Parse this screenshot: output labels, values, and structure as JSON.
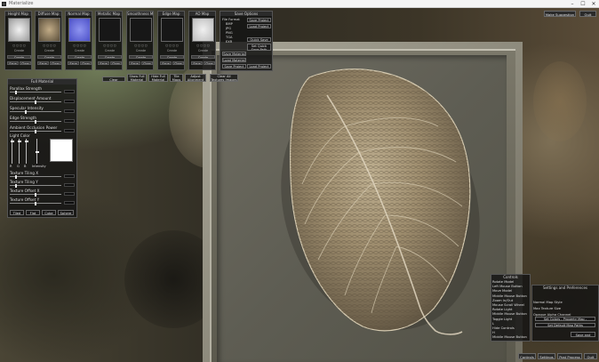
{
  "window": {
    "title": "Materialize",
    "controls": [
      "–",
      "☐",
      "✕"
    ]
  },
  "maps": [
    {
      "title": "Height Map",
      "image": "height",
      "subtitle": "Create",
      "buttons": [
        "Save",
        "Clear"
      ]
    },
    {
      "title": "Diffuse Map",
      "image": "diffuse",
      "subtitle": "Create",
      "buttons": [
        "Save",
        "Clear"
      ]
    },
    {
      "title": "Normal Map",
      "image": "normal",
      "subtitle": "Create",
      "buttons": [
        "Save",
        "Clear"
      ]
    },
    {
      "title": "Metallic Map",
      "image": "empty",
      "subtitle": "Create",
      "buttons": [
        "Save",
        "Clear"
      ]
    },
    {
      "title": "Smoothness Map",
      "image": "empty",
      "subtitle": "Create",
      "buttons": [
        "Save",
        "Clear"
      ]
    },
    {
      "title": "Edge Map",
      "image": "empty",
      "subtitle": "Create",
      "buttons": [
        "Save",
        "Clear"
      ]
    },
    {
      "title": "AO Map",
      "image": "ao",
      "subtitle": "Create",
      "buttons": [
        "Save",
        "Clear"
      ]
    }
  ],
  "save_panel": {
    "title": "Save Options",
    "options": [
      "File Format",
      "BMP",
      "JPG",
      "PNG",
      "TGA",
      "EXR"
    ],
    "right_buttons": [
      "Save Project",
      "Load Project",
      "Quick Save",
      "Set Quick Save Path"
    ],
    "bottom_buttons": [
      "Save Material",
      "Load Material",
      "Save Project",
      "Load Project"
    ]
  },
  "toolbar": [
    "Clear Textures",
    "Show Full Material",
    "Hide Full Material",
    "Tile Maps",
    "Adjust Alignment",
    "Clear All Textures Images"
  ],
  "full_material": {
    "title": "Full Material",
    "sliders": [
      {
        "label": "Parallax Strength",
        "pos": 0.1
      },
      {
        "label": "Displacement Amount",
        "pos": 0.5
      },
      {
        "label": "Specular Intensity",
        "pos": 0.3
      },
      {
        "label": "Edge Strength",
        "pos": 0.5
      },
      {
        "label": "Ambient Occlusion Power",
        "pos": 0.5
      }
    ],
    "light_color_label": "Light Color",
    "rgb_labels": [
      "R",
      "G",
      "B",
      "Intensity"
    ],
    "more_sliders": [
      {
        "label": "Texture Tiling X",
        "pos": 0.1
      },
      {
        "label": "Texture Tiling Y",
        "pos": 0.1
      },
      {
        "label": "Texture Offset X",
        "pos": 0.5
      },
      {
        "label": "Texture Offset Y",
        "pos": 0.5
      }
    ],
    "buttons": [
      "Tiled",
      "Flat",
      "Cube",
      "Sphere"
    ]
  },
  "controls": {
    "title": "Controls",
    "lines": [
      "Rotate Model",
      "Left Mouse Button",
      "Move Model",
      "Middle Mouse Button",
      "Zoom In/Out",
      "Mouse Scroll Wheel",
      "Rotate Light",
      "Middle Mouse Button",
      "Toggle Light",
      "L",
      "Hide Controls",
      "H",
      "Middle Mouse Button"
    ]
  },
  "help": {
    "title": "Settings and Preferences",
    "lines": [
      "Normal Map Style",
      "Max Texture Size",
      "Opaque Alpha Channel",
      "Set Colors - Property Map - Channels",
      "Set Default Map Paths"
    ],
    "button": "Save and Close"
  },
  "top_right": {
    "suggest": "Make Suggestion",
    "quit": "Quit"
  },
  "bottom_bar": [
    "Controls",
    "Settings",
    "Post Process",
    "Quit"
  ]
}
